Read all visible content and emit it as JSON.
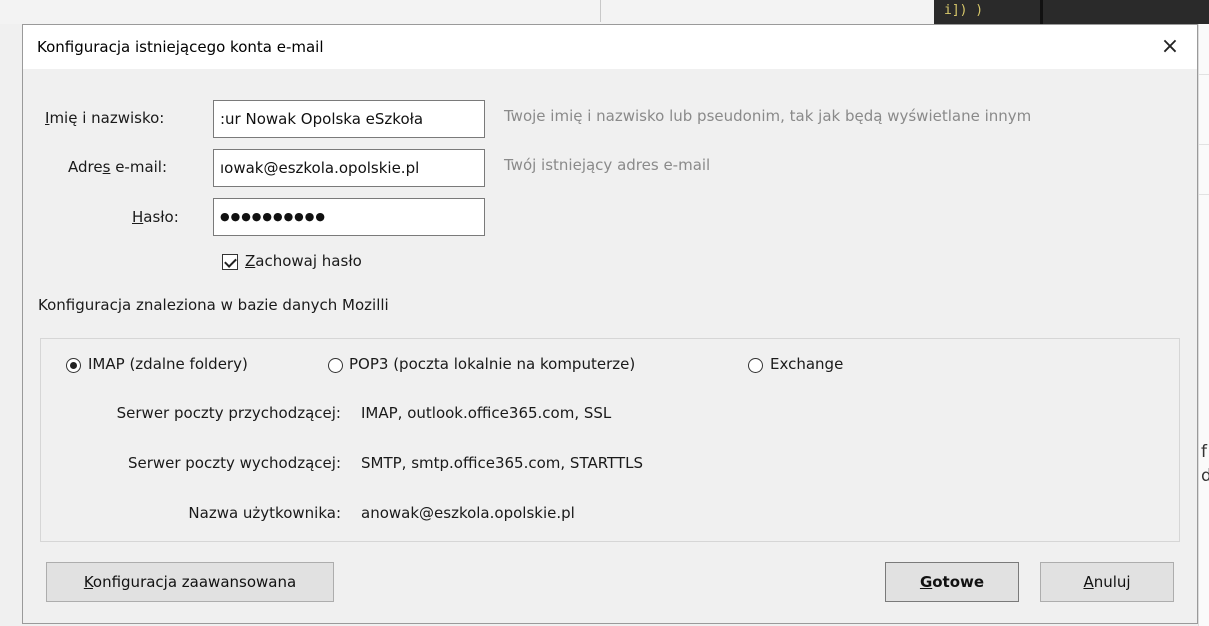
{
  "background": {
    "code_fragment": "i]) )",
    "right_fragment_1": "f",
    "right_fragment_2": "d"
  },
  "dialog": {
    "title": "Konfiguracja istniejącego konta e-mail",
    "close_icon": "×"
  },
  "form": {
    "name": {
      "label_underlined": "I",
      "label_rest": "mię i nazwisko:",
      "value": ":ur Nowak Opolska eSzkoła",
      "hint": "Twoje imię i nazwisko lub pseudonim, tak jak będą wyświetlane innym"
    },
    "email": {
      "label_before": "Adre",
      "label_underlined": "s",
      "label_after": " e-mail:",
      "value": "ıowak@eszkola.opolskie.pl",
      "hint": "Twój istniejący adres e-mail"
    },
    "password": {
      "label_underlined": "H",
      "label_rest": "asło:",
      "value": "●●●●●●●●●●"
    },
    "remember": {
      "checked": true,
      "label_underlined": "Z",
      "label_rest": "achowaj hasło"
    }
  },
  "status_text": "Konfiguracja znaleziona w bazie danych Mozilli",
  "protocols": {
    "selected": "IMAP",
    "options": [
      "IMAP (zdalne foldery)",
      "POP3 (poczta lokalnie na komputerze)",
      "Exchange"
    ]
  },
  "servers": {
    "incoming_label": "Serwer poczty przychodzącej:",
    "incoming_value": "IMAP, outlook.office365.com, SSL",
    "outgoing_label": "Serwer poczty wychodzącej:",
    "outgoing_value": "SMTP, smtp.office365.com, STARTTLS",
    "username_label": "Nazwa użytkownika:",
    "username_value": "anowak@eszkola.opolskie.pl"
  },
  "buttons": {
    "advanced_underlined": "K",
    "advanced_rest": "onfiguracja zaawansowana",
    "done_underlined": "G",
    "done_rest": "otowe",
    "cancel_underlined": "A",
    "cancel_rest": "nuluj"
  }
}
